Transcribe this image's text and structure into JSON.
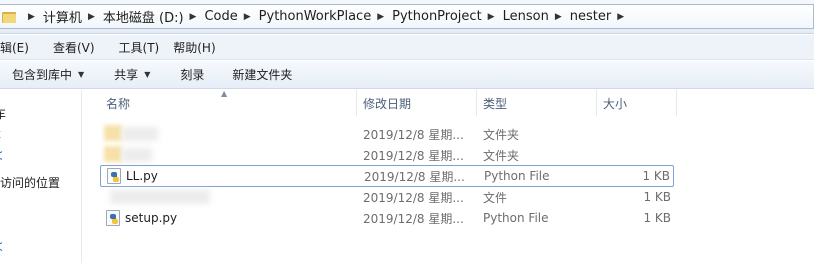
{
  "address_bar": {
    "crumbs": [
      "计算机",
      "本地磁盘 (D:)",
      "Code",
      "PythonWorkPlace",
      "PythonProject",
      "Lenson",
      "nester"
    ]
  },
  "menubar": {
    "items": [
      "编辑(E)",
      "查看(V)",
      "工具(T)",
      "帮助(H)"
    ],
    "visible": [
      "辑(E)",
      "查看(V)",
      "工具(T)",
      "帮助(H)"
    ]
  },
  "toolbar": {
    "include_library": "包含到库中",
    "share": "共享",
    "burn": "刻录",
    "new_folder": "新建文件夹"
  },
  "nav_pane": {
    "items": [
      "车",
      "ᴋ",
      "ᐸ",
      "访问的位置",
      "ᐸ"
    ]
  },
  "columns": {
    "name": "名称",
    "date": "修改日期",
    "type": "类型",
    "size": "大小"
  },
  "files": [
    {
      "name": "",
      "date": "2019/12/8 星期...",
      "type": "文件夹",
      "size": "",
      "icon": "folder-icon"
    },
    {
      "name": "",
      "date": "2019/12/8 星期...",
      "type": "文件夹",
      "size": "",
      "icon": "folder-icon"
    },
    {
      "name": "LL.py",
      "date": "2019/12/8 星期...",
      "type": "Python File",
      "size": "1 KB",
      "icon": "python-file-icon"
    },
    {
      "name": "",
      "date": "2019/12/8 星期...",
      "type": "文件",
      "size": "1 KB",
      "icon": "file-icon"
    },
    {
      "name": "setup.py",
      "date": "2019/12/8 星期...",
      "type": "Python File",
      "size": "1 KB",
      "icon": "python-file-icon"
    }
  ]
}
